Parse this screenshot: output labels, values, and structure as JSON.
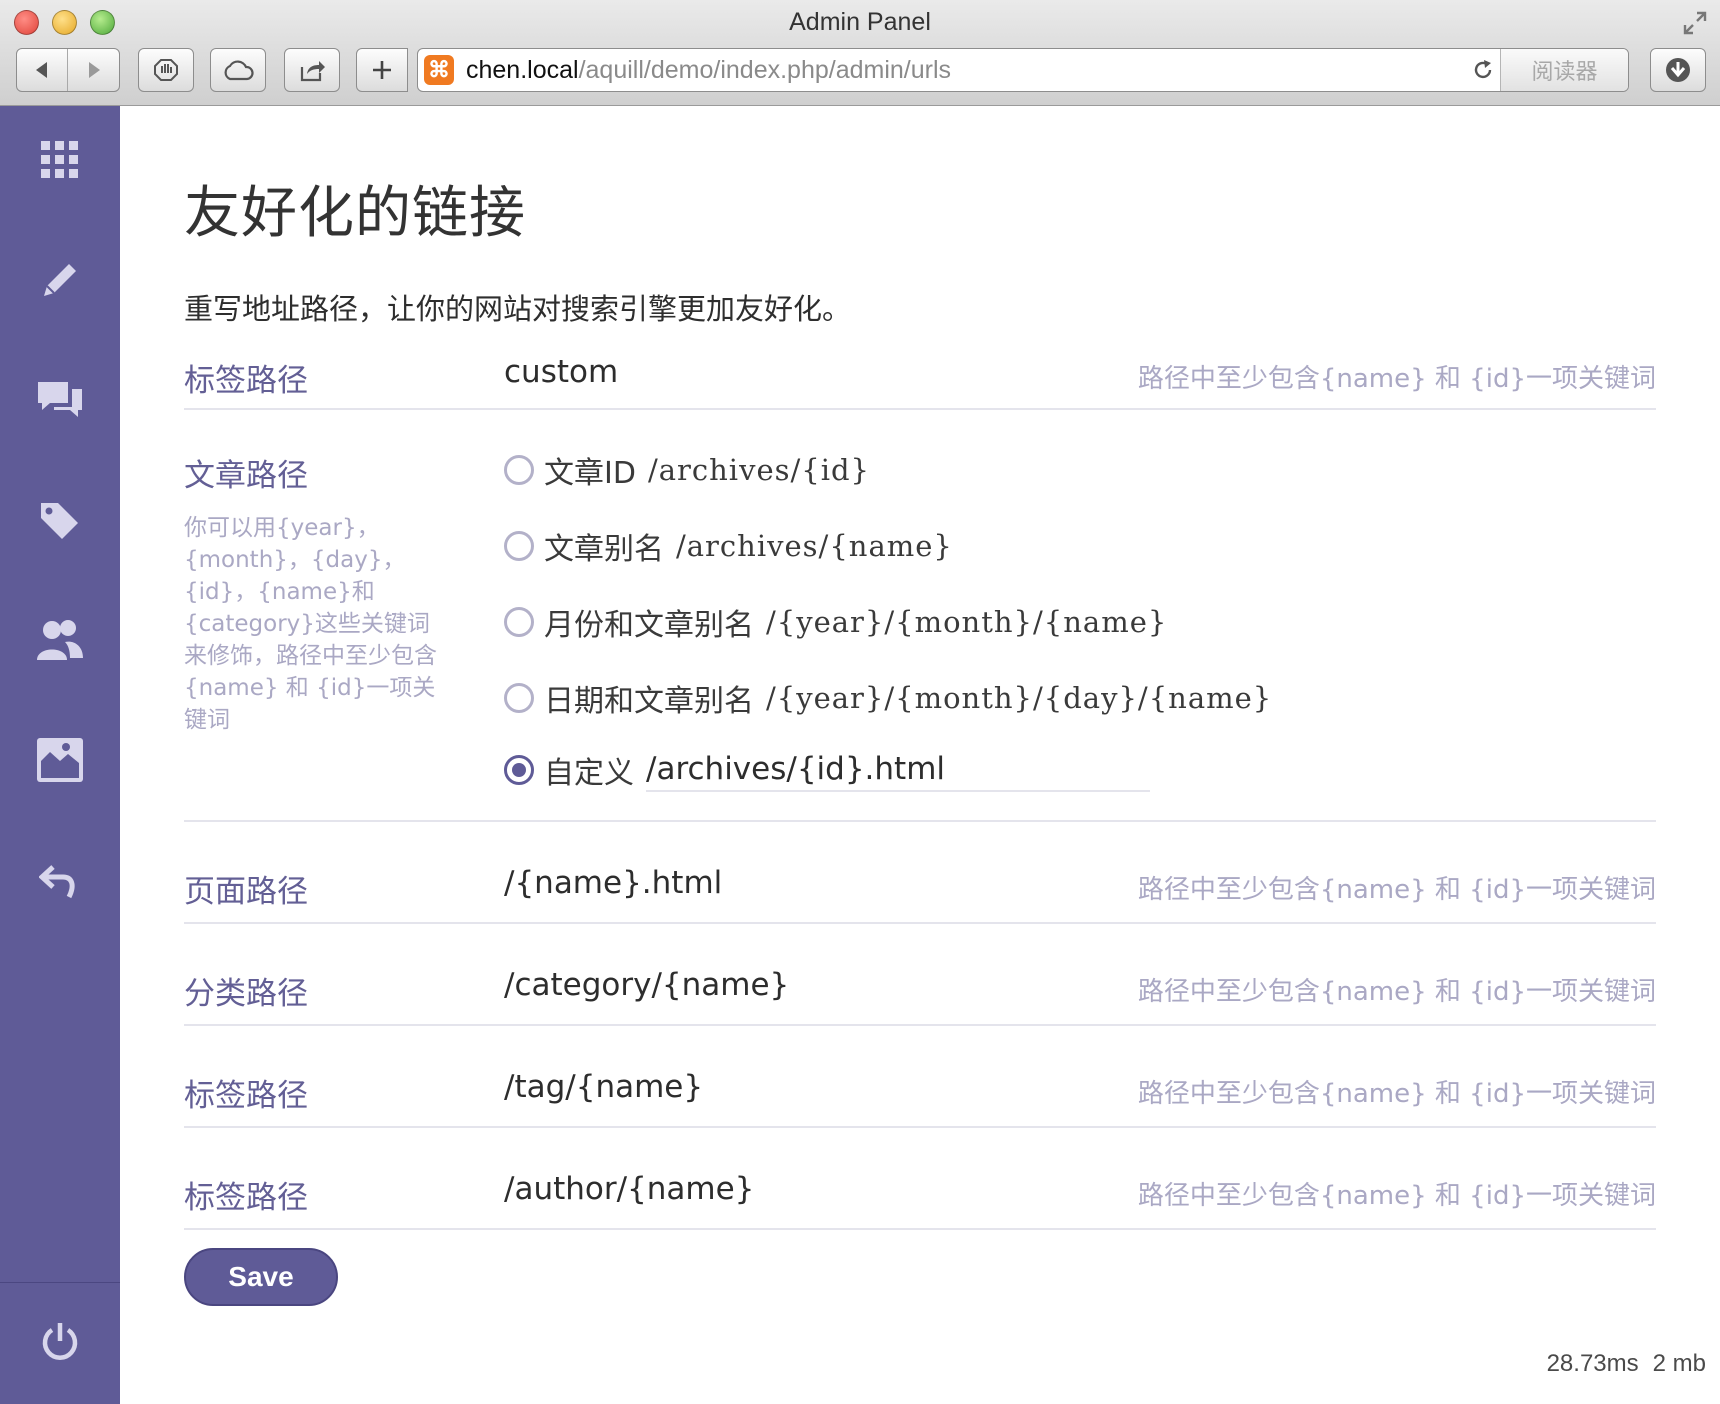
{
  "window": {
    "title": "Admin Panel"
  },
  "toolbar": {
    "url_host": "chen.local",
    "url_path": "/aquill/demo/index.php/admin/urls",
    "reader_label": "阅读器",
    "favicon_glyph": "⌘"
  },
  "sidebar": {
    "items": [
      {
        "icon": "grid-icon"
      },
      {
        "icon": "pencil-icon"
      },
      {
        "icon": "comments-icon"
      },
      {
        "icon": "tag-icon"
      },
      {
        "icon": "users-icon"
      },
      {
        "icon": "image-icon"
      },
      {
        "icon": "undo-icon"
      }
    ],
    "footer_icon": "power-icon",
    "background": "#5f5b97"
  },
  "page": {
    "title": "友好化的链接",
    "description": "重写地址路径，让你的网站对搜索引擎更加友好化。"
  },
  "hint": "路径中至少包含{name} 和 {id}一项关键词",
  "rows": {
    "tag_path_custom": {
      "label": "标签路径",
      "value": "custom"
    },
    "article": {
      "label": "文章路径",
      "note": "你可以用{year}，{month}，{day}，{id}，{name}和{category}这些关键词来修饰，路径中至少包含{name} 和 {id}一项关键词",
      "options": [
        {
          "label": "文章ID",
          "pattern": "/archives/{id}",
          "checked": false
        },
        {
          "label": "文章别名",
          "pattern": "/archives/{name}",
          "checked": false
        },
        {
          "label": "月份和文章别名",
          "pattern": "/{year}/{month}/{name}",
          "checked": false
        },
        {
          "label": "日期和文章别名",
          "pattern": "/{year}/{month}/{day}/{name}",
          "checked": false
        },
        {
          "label": "自定义",
          "value": "/archives/{id}.html",
          "checked": true
        }
      ]
    },
    "page": {
      "label": "页面路径",
      "value": "/{name}.html"
    },
    "category": {
      "label": "分类路径",
      "value": "/category/{name}"
    },
    "tag": {
      "label": "标签路径",
      "value": "/tag/{name}"
    },
    "author": {
      "label": "标签路径",
      "value": "/author/{name}"
    }
  },
  "actions": {
    "save_label": "Save"
  },
  "footer_stats": {
    "time": "28.73ms",
    "memory": "2 mb"
  },
  "colors": {
    "accent": "#5f5b97",
    "label": "#635f95",
    "hint": "#aaa8c4"
  }
}
